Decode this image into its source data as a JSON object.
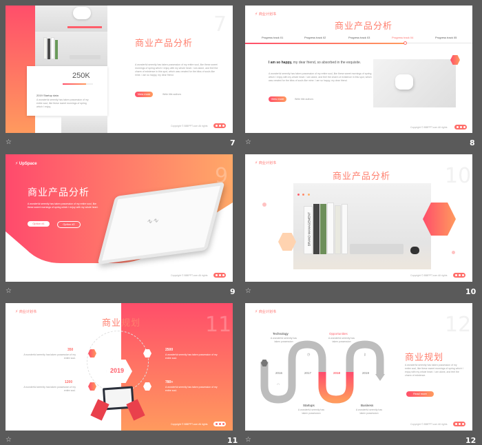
{
  "slides": {
    "s7": {
      "number": "7",
      "ghost_number": "7",
      "title": "商业产品分析",
      "stat": "250K",
      "stat_caption": "2019 Startup data",
      "stat_desc": "A wonderful serenity has taken possession of my entire soul, like these sweet mornings of spring which I enjoy.",
      "body": "A wonderful serenity has taken possession of my entire soul, like these sweet mornings of spring which I enjoy with my whole heart. I am alone, and feel the charm of existence in this spot, which was created for the bliss of souls like mine. I am so happy, my dear friend.",
      "button": "View more",
      "link": "Write title authors",
      "copyright": "Copyright © 888PPT.com All rights"
    },
    "s8": {
      "number": "8",
      "logo": "商业计划书",
      "title": "商业产品分析",
      "tracks": [
        "Progress track 01",
        "Progress track 02",
        "Progress track 03",
        "Progress track 04",
        "Progress track 05"
      ],
      "headline_bold": "I am so happy,",
      "headline_rest": " my dear friend, so absorbed in the exquisite.",
      "body": "A wonderful serenity has taken possession of my entire soul, like these sweet mornings of spring which I enjoy with my whole heart. I am alone, and feel the charm of existence in this spot, which was created for the bliss of souls like mine. I am so happy, my dear friend.",
      "button": "View more",
      "link": "Write title authors",
      "copyright": "Copyright © 888PPT.com All rights"
    },
    "s9": {
      "number": "9",
      "ghost_number": "9",
      "logo": "UpSpace",
      "title": "商业产品分析",
      "body": "A wonderful serenity has taken possession of my entire soul, like these sweet mornings of spring which I enjoy with my whole heart.",
      "option1": "Option #1",
      "option2": "Option #2",
      "copyright": "Copyright © 888PPT.com All rights"
    },
    "s10": {
      "number": "10",
      "ghost_number": "10",
      "logo": "商业计划书",
      "title": "商业产品分析",
      "book_text": "BRAND MANAGEMENT",
      "copyright": "Copyright © 888PPT.com All rights"
    },
    "s11": {
      "number": "11",
      "ghost_number": "11",
      "logo": "商业计划书",
      "title": "商业规划",
      "year": "2019",
      "items": [
        {
          "value": "350",
          "desc": "A wonderful serenity has taken possession of my entire soul."
        },
        {
          "value": "1200",
          "desc": "A wonderful serenity has taken possession of my entire soul."
        },
        {
          "value": "2500",
          "desc": "A wonderful serenity has taken possession of my entire soul."
        },
        {
          "value": "780+",
          "desc": "A wonderful serenity has taken possession of my entire soul."
        }
      ],
      "copyright": "Copyright © 888PPT.com All rights"
    },
    "s12": {
      "number": "12",
      "ghost_number": "12",
      "logo": "商业计划书",
      "title": "商业规划",
      "labels": {
        "technology": "Technology",
        "opportunities": "Opportunities",
        "startups": "Startups",
        "business": "Business"
      },
      "label_desc": "A wonderful serenity has taken possession",
      "years": [
        "2016",
        "2017",
        "2018",
        "2019"
      ],
      "body": "A wonderful serenity has taken possession of my entire soul, like these sweet mornings of spring which I enjoy with my whole heart. I am alone, and feel the charm of existence.",
      "button": "Read more",
      "copyright": "Copyright © 888PPT.com All rights"
    }
  }
}
